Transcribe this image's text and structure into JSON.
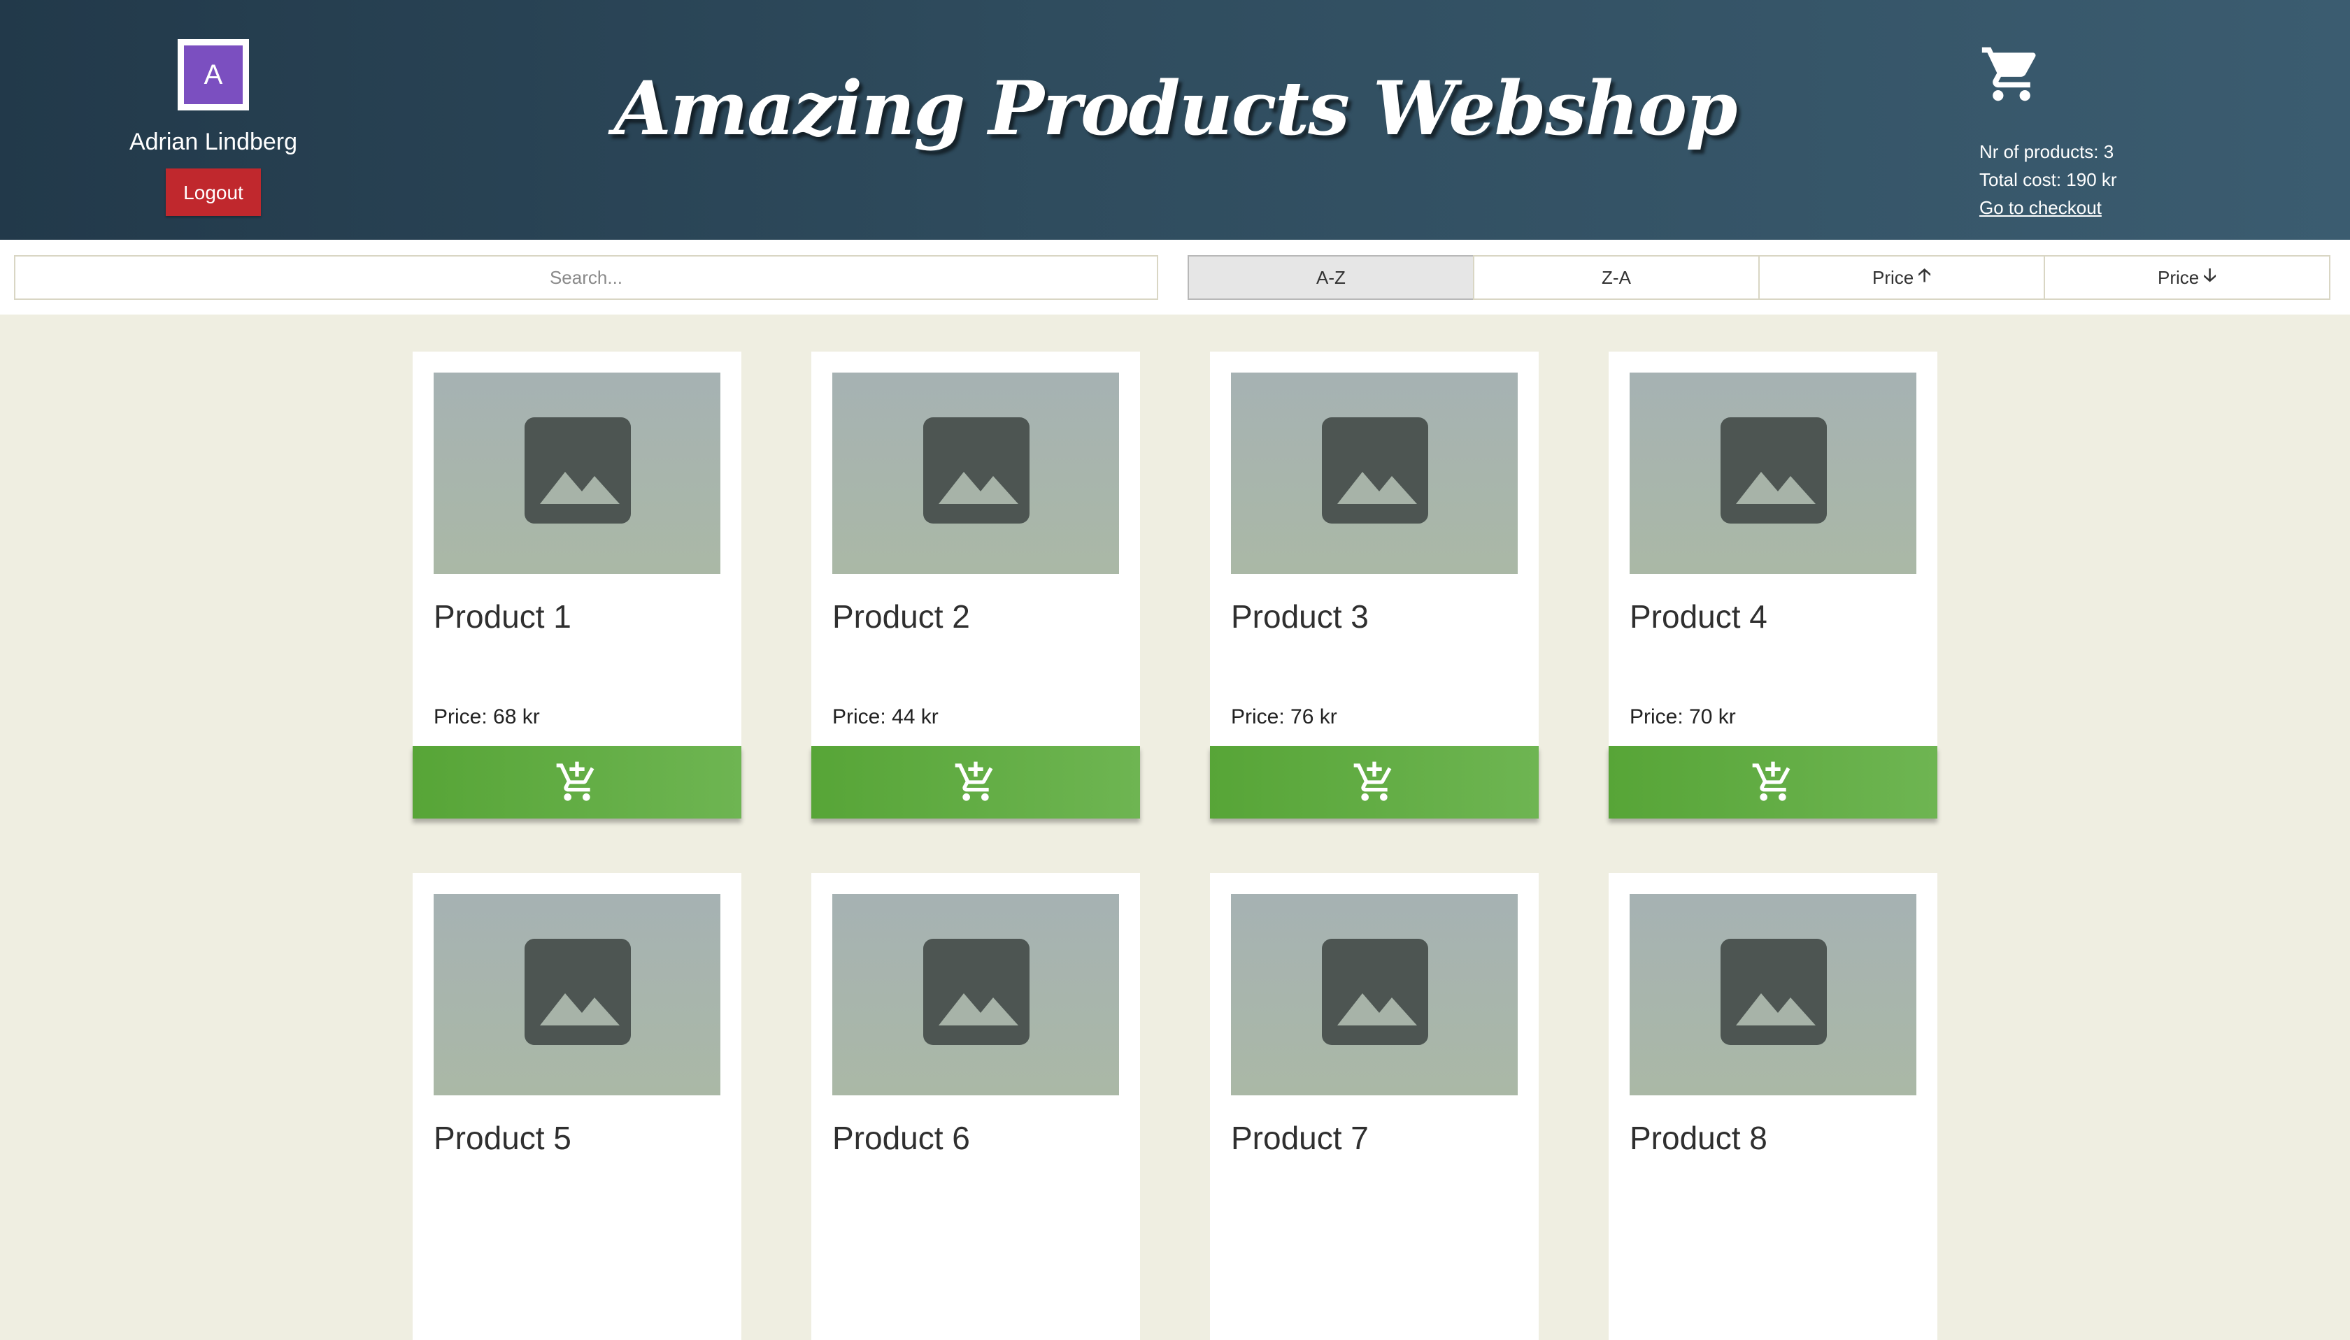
{
  "header": {
    "title": "Amazing Products Webshop",
    "user": {
      "initial": "A",
      "name": "Adrian Lindberg",
      "logout_label": "Logout"
    },
    "cart": {
      "icon": "shopping-cart-icon",
      "count_text": "Nr of products: 3",
      "total_text": "Total cost: 190 kr",
      "checkout_label": "Go to checkout"
    }
  },
  "toolbar": {
    "search_placeholder": "Search...",
    "sort_options": [
      {
        "label": "A-Z",
        "arrow": "",
        "active": true
      },
      {
        "label": "Z-A",
        "arrow": "",
        "active": false
      },
      {
        "label": "Price",
        "arrow": "🡡",
        "active": false
      },
      {
        "label": "Price",
        "arrow": "🡣",
        "active": false
      }
    ]
  },
  "products": [
    {
      "name": "Product 1",
      "price_text": "Price: 68 kr"
    },
    {
      "name": "Product 2",
      "price_text": "Price: 44 kr"
    },
    {
      "name": "Product 3",
      "price_text": "Price: 76 kr"
    },
    {
      "name": "Product 4",
      "price_text": "Price: 70 kr"
    },
    {
      "name": "Product 5",
      "price_text": ""
    },
    {
      "name": "Product 6",
      "price_text": ""
    },
    {
      "name": "Product 7",
      "price_text": ""
    },
    {
      "name": "Product 8",
      "price_text": ""
    }
  ],
  "colors": {
    "header_dark": "#22394a",
    "logout_red": "#c0282d",
    "avatar_purple": "#7b4fc0",
    "add_green": "#57a537",
    "page_bg": "#efeee1"
  },
  "icons": {
    "product_image": "image-placeholder-icon",
    "add_to_cart": "add-to-cart-icon"
  }
}
